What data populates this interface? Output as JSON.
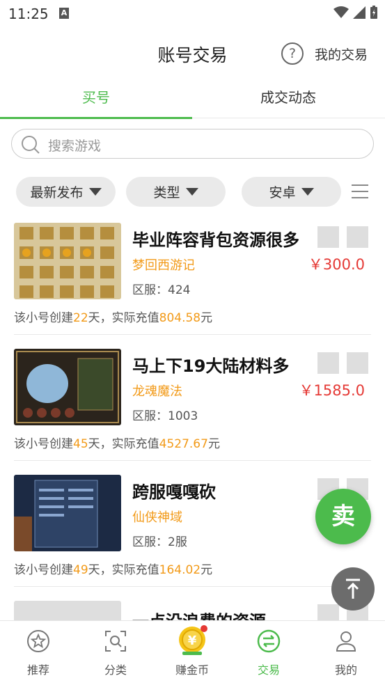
{
  "status": {
    "time": "11:25"
  },
  "header": {
    "title": "账号交易",
    "help": "?",
    "my_trade": "我的交易"
  },
  "tabs": [
    {
      "label": "买号"
    },
    {
      "label": "成交动态"
    }
  ],
  "search": {
    "placeholder": "搜索游戏"
  },
  "filters": [
    {
      "label": "最新发布"
    },
    {
      "label": "类型"
    },
    {
      "label": "安卓"
    }
  ],
  "listings": [
    {
      "name": "毕业阵容背包资源很多",
      "game": "梦回西游记",
      "server": "区服：424",
      "price": "￥300.0",
      "desc_prefix": "该小号创建",
      "days": "22",
      "desc_mid": "天，实际充值",
      "amount": "804.58",
      "desc_suffix": "元"
    },
    {
      "name": "马上下19大陆材料多",
      "game": "龙魂魔法",
      "server": "区服：1003",
      "price": "￥1585.0",
      "desc_prefix": "该小号创建",
      "days": "45",
      "desc_mid": "天，实际充值",
      "amount": "4527.67",
      "desc_suffix": "元"
    },
    {
      "name": "跨服嘎嘎砍",
      "game": "仙侠神域",
      "server": "区服：2服",
      "price": "￥",
      "desc_prefix": "该小号创建",
      "days": "49",
      "desc_mid": "天，实际充值",
      "amount": "164.02",
      "desc_suffix": "元"
    },
    {
      "name": "一点没浪费的资源，"
    }
  ],
  "float": {
    "sell": "卖"
  },
  "nav": [
    {
      "label": "推荐"
    },
    {
      "label": "分类"
    },
    {
      "label": "赚金币"
    },
    {
      "label": "交易"
    },
    {
      "label": "我的"
    }
  ],
  "colors": {
    "accent": "#4cbb4c",
    "price": "#e53935",
    "highlight": "#f29a18"
  }
}
